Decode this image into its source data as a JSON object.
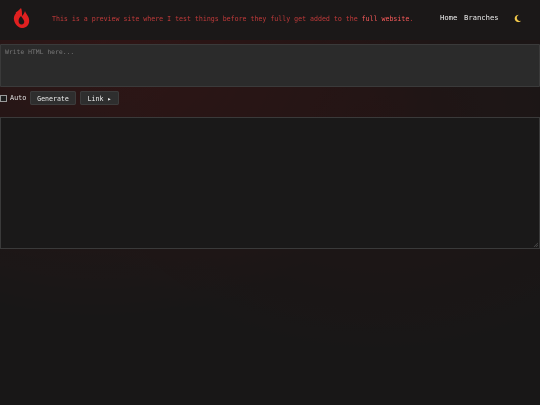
{
  "header": {
    "notice_prefix": "This is a preview site where I test things before they fully get added to the",
    "notice_link": "full website",
    "notice_suffix": ".",
    "nav": {
      "home": "Home",
      "branches": "Branches"
    },
    "icons": {
      "logo": "flame-logo-icon",
      "theme": "moon-icon"
    }
  },
  "editor": {
    "placeholder": "Write HTML here..."
  },
  "controls": {
    "auto_label": "Auto",
    "generate_label": "Generate",
    "link_label": "Link ▸"
  },
  "colors": {
    "accent": "#e02020",
    "notice": "#c23a3a",
    "background": "#181717",
    "panel": "#2b2b2b"
  }
}
